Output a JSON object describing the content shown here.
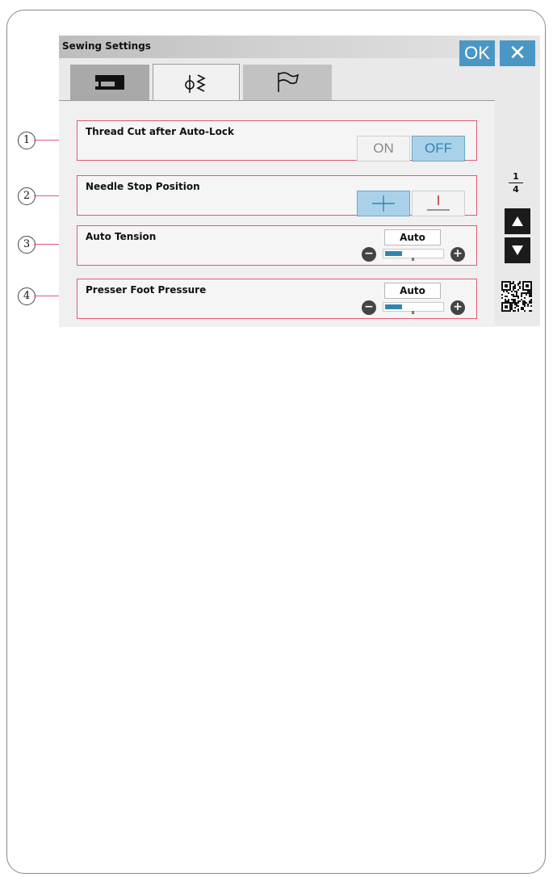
{
  "window": {
    "title": "Sewing Settings",
    "ok_label": "OK",
    "close_label": "✕"
  },
  "tabs": [
    {
      "name": "machine-settings",
      "icon": "sewing-machine-icon",
      "active": false
    },
    {
      "name": "stitch-settings",
      "icon": "stitch-icon",
      "active": true
    },
    {
      "name": "language-settings",
      "icon": "flag-icon",
      "active": false
    }
  ],
  "settings": [
    {
      "callout": "1",
      "label": "Thread Cut after Auto-Lock",
      "control": "toggle",
      "options": [
        "ON",
        "OFF"
      ],
      "selected": "OFF"
    },
    {
      "callout": "2",
      "label": "Needle Stop Position",
      "control": "icon-toggle",
      "options": [
        "needle-down-icon",
        "needle-up-icon"
      ],
      "selected": "needle-down-icon"
    },
    {
      "callout": "3",
      "label": "Auto Tension",
      "control": "slider",
      "value_label": "Auto",
      "level": 0.5
    },
    {
      "callout": "4",
      "label": "Presser Foot Pressure",
      "control": "slider",
      "value_label": "Auto",
      "level": 0.5
    }
  ],
  "pager": {
    "current": "1",
    "total": "4"
  },
  "colors": {
    "accent": "#4a97c6",
    "highlight": "#a9d2ea",
    "border_pink": "#e05a74"
  }
}
